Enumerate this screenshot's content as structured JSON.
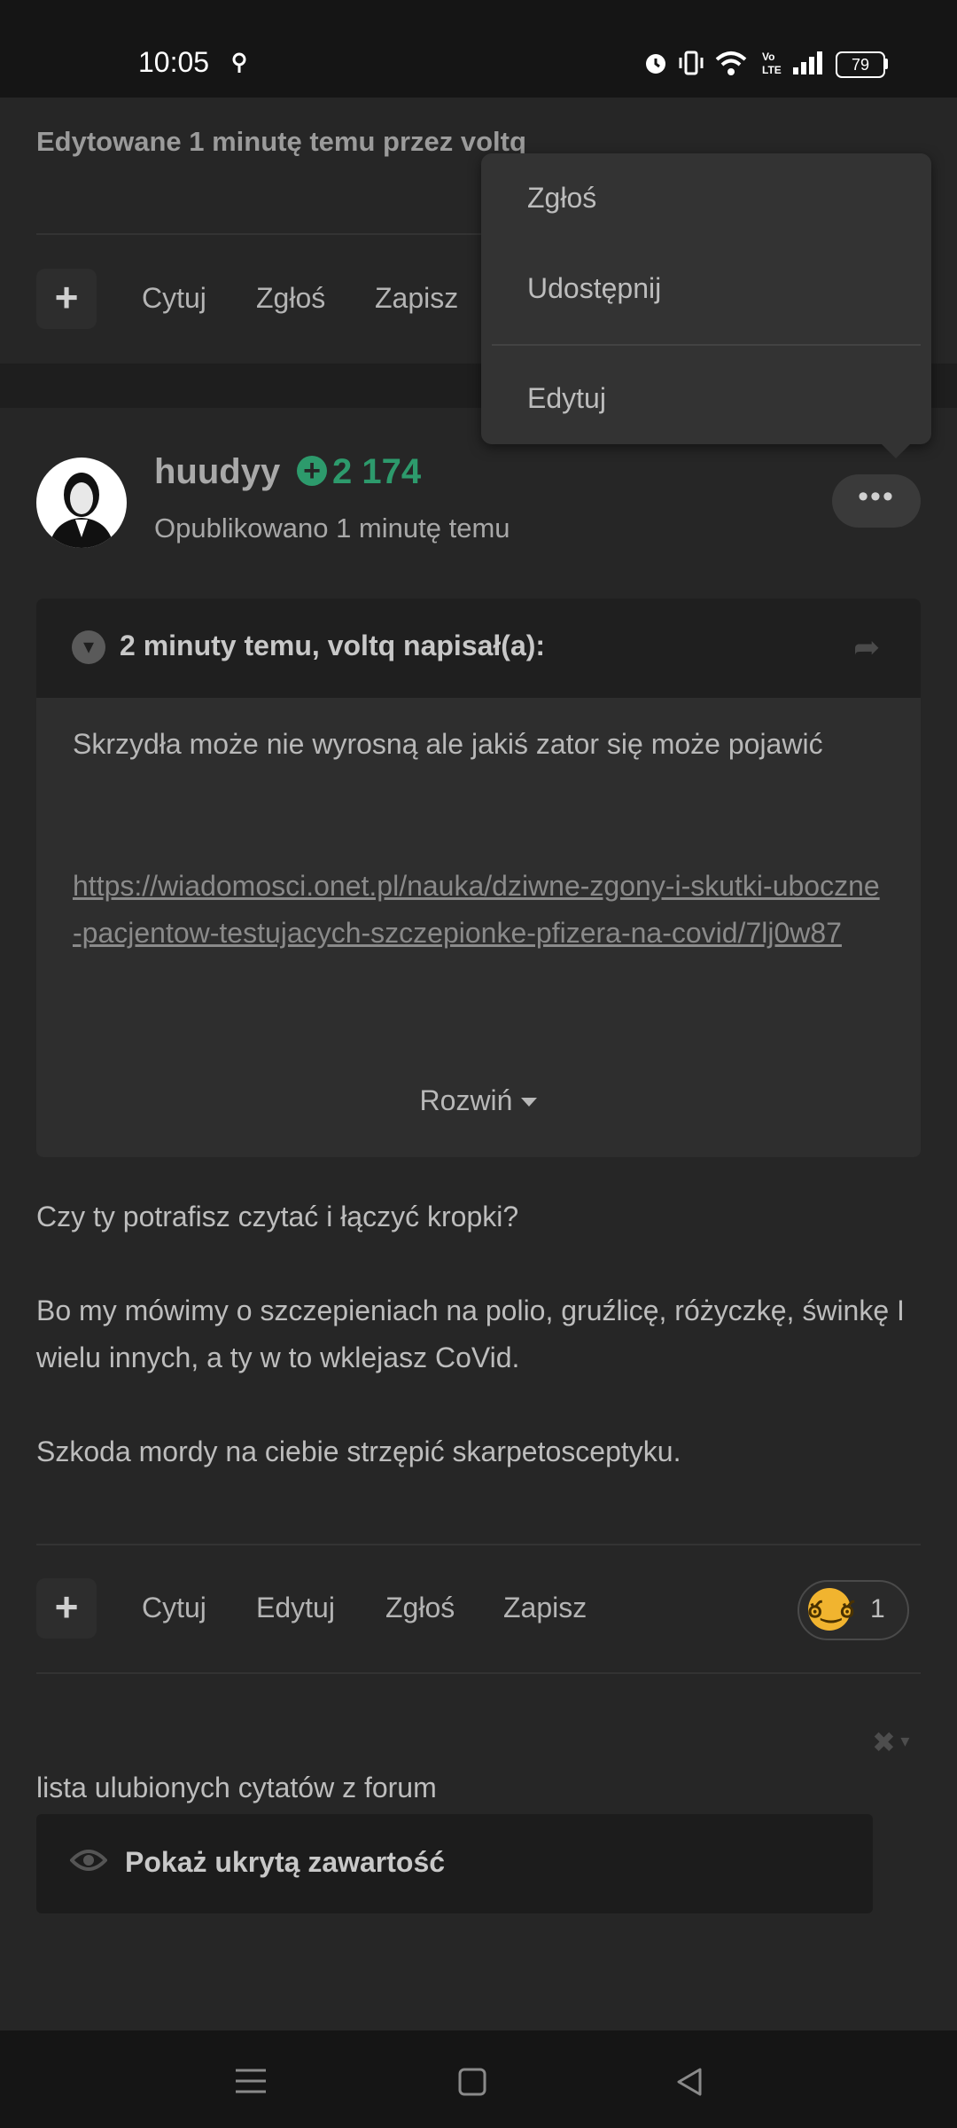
{
  "status_bar": {
    "time": "10:05",
    "battery": "79"
  },
  "previous_post": {
    "edited_note": "Edytowane 1 minutę temu przez voltq",
    "actions": {
      "quote": "Cytuj",
      "report": "Zgłoś",
      "save": "Zapisz"
    }
  },
  "menu": {
    "items": [
      "Zgłoś",
      "Udostępnij",
      "Edytuj"
    ]
  },
  "post": {
    "author": "huudyy",
    "reputation": "2 174",
    "published": "Opublikowano 1 minutę temu",
    "quote": {
      "citation": "2 minuty temu, voltq napisał(a):",
      "text": "Skrzydła może nie wyrosną ale jakiś zator się może pojawić",
      "link": "https://wiadomosci.onet.pl/nauka/dziwne-zgony-i-skutki-uboczne-pacjentow-testujacych-szczepionke-pfizera-na-covid/7lj0w87",
      "expand": "Rozwiń"
    },
    "paragraphs": [
      "Czy ty potrafisz czytać i łączyć kropki?",
      "Bo my mówimy o szczepieniach na polio, gruźlicę, różyczkę, świnkę I wielu innych, a ty w to wklejasz CoVid.",
      "Szkoda mordy na ciebie strzępić skarpetosceptyku."
    ],
    "actions": {
      "quote": "Cytuj",
      "edit": "Edytuj",
      "report": "Zgłoś",
      "save": "Zapisz"
    },
    "reaction_count": "1",
    "signature": {
      "label": "lista ulubionych cytatów z forum",
      "spoiler": "Pokaż ukrytą zawartość"
    }
  },
  "icons": [
    "location-icon",
    "alarm-icon",
    "vibrate-icon",
    "wifi-icon",
    "volte-icon",
    "signal-icon",
    "battery-icon",
    "plus-icon",
    "more-icon",
    "chevron-down-icon",
    "share-icon",
    "reaction-emoji-icon",
    "close-icon",
    "eye-icon",
    "menu-icon",
    "home-icon",
    "back-icon"
  ]
}
